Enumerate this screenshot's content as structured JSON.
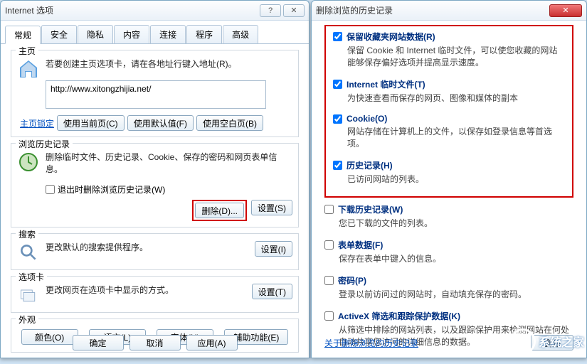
{
  "left_dialog": {
    "title": "Internet 选项",
    "tabs": [
      "常规",
      "安全",
      "隐私",
      "内容",
      "连接",
      "程序",
      "高级"
    ],
    "active_tab": 0,
    "home": {
      "group_label": "主页",
      "desc": "若要创建主页选项卡，请在各地址行键入地址(R)。",
      "url": "http://www.xitongzhijia.net/",
      "lock_link": "主页锁定",
      "btn_current": "使用当前页(C)",
      "btn_default": "使用默认值(F)",
      "btn_blank": "使用空白页(B)"
    },
    "history": {
      "group_label": "浏览历史记录",
      "desc": "删除临时文件、历史记录、Cookie、保存的密码和网页表单信息。",
      "exit_delete_label": "退出时删除浏览历史记录(W)",
      "btn_delete": "删除(D)...",
      "btn_settings": "设置(S)"
    },
    "search": {
      "group_label": "搜索",
      "desc": "更改默认的搜索提供程序。",
      "btn_settings": "设置(I)"
    },
    "tabs_group": {
      "group_label": "选项卡",
      "desc": "更改网页在选项卡中显示的方式。",
      "btn_settings": "设置(T)"
    },
    "appearance": {
      "group_label": "外观",
      "btn_color": "颜色(O)",
      "btn_lang": "语言(L)",
      "btn_font": "字体(N)",
      "btn_access": "辅助功能(E)"
    },
    "bottom": {
      "ok": "确定",
      "cancel": "取消",
      "apply": "应用(A)"
    }
  },
  "right_dialog": {
    "title": "删除浏览的历史记录",
    "items": [
      {
        "checked": true,
        "title": "保留收藏夹网站数据(R)",
        "desc": "保留 Cookie 和 Internet 临时文件，可以使您收藏的网站能够保存偏好选项并提高显示速度。"
      },
      {
        "checked": true,
        "title": "Internet 临时文件(T)",
        "desc": "为快速查看而保存的网页、图像和媒体的副本"
      },
      {
        "checked": true,
        "title": "Cookie(O)",
        "desc": "网站存储在计算机上的文件，以保存如登录信息等首选项。"
      },
      {
        "checked": true,
        "title": "历史记录(H)",
        "desc": "已访问网站的列表。"
      },
      {
        "checked": false,
        "title": "下载历史记录(W)",
        "desc": "您已下载的文件的列表。"
      },
      {
        "checked": false,
        "title": "表单数据(F)",
        "desc": "保存在表单中键入的信息。"
      },
      {
        "checked": false,
        "title": "密码(P)",
        "desc": "登录以前访问过的网站时，自动填充保存的密码。"
      },
      {
        "checked": false,
        "title": "ActiveX 筛选和跟踪保护数据(K)",
        "desc": "从筛选中排除的网站列表，以及跟踪保护用来检测网站在何处自动共享您访问的详细信息的数据。"
      }
    ],
    "highlight_first_n": 4,
    "about_link": "关于删除浏览的历史记录",
    "btn_delete": "删除"
  },
  "watermark": "系统之家"
}
